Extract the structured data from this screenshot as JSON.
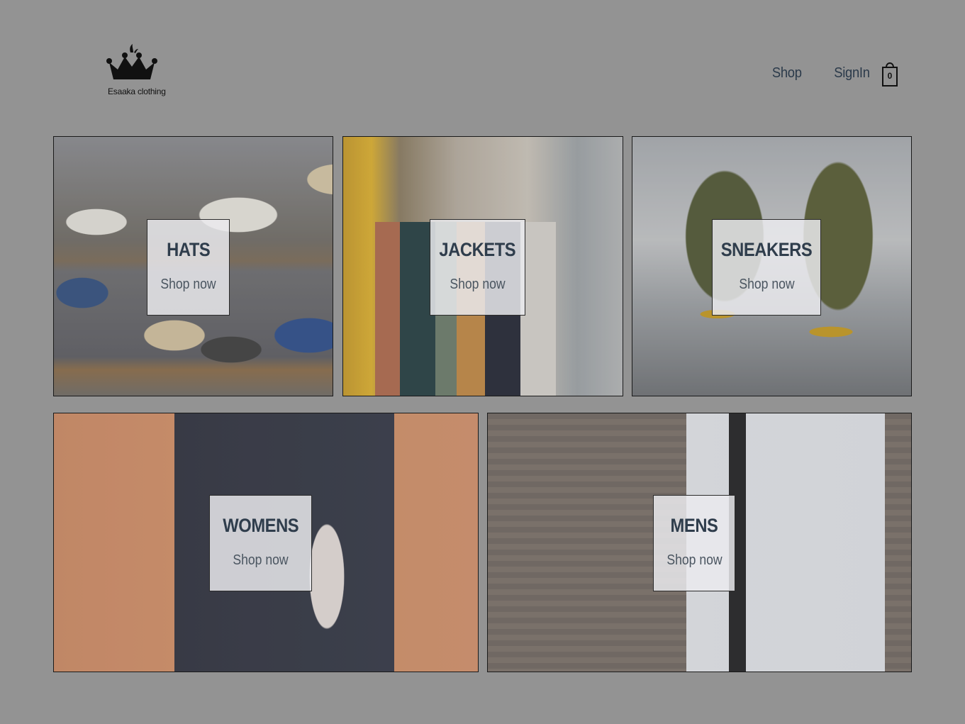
{
  "brand": {
    "name": "Esaaka clothing",
    "logo_icon": "crown-icon"
  },
  "nav": {
    "shop_label": "Shop",
    "signin_label": "SignIn",
    "cart_count": "0",
    "cart_icon": "shopping-bag-icon"
  },
  "categories": [
    {
      "title": "HATS",
      "cta": "Shop now"
    },
    {
      "title": "JACKETS",
      "cta": "Shop now"
    },
    {
      "title": "SNEAKERS",
      "cta": "Shop now"
    },
    {
      "title": "WOMENS",
      "cta": "Shop now"
    },
    {
      "title": "MENS",
      "cta": "Shop now"
    }
  ],
  "colors": {
    "page_background": "#939393",
    "title_text": "#2f3d4c",
    "nav_text": "#2b3a4a"
  }
}
